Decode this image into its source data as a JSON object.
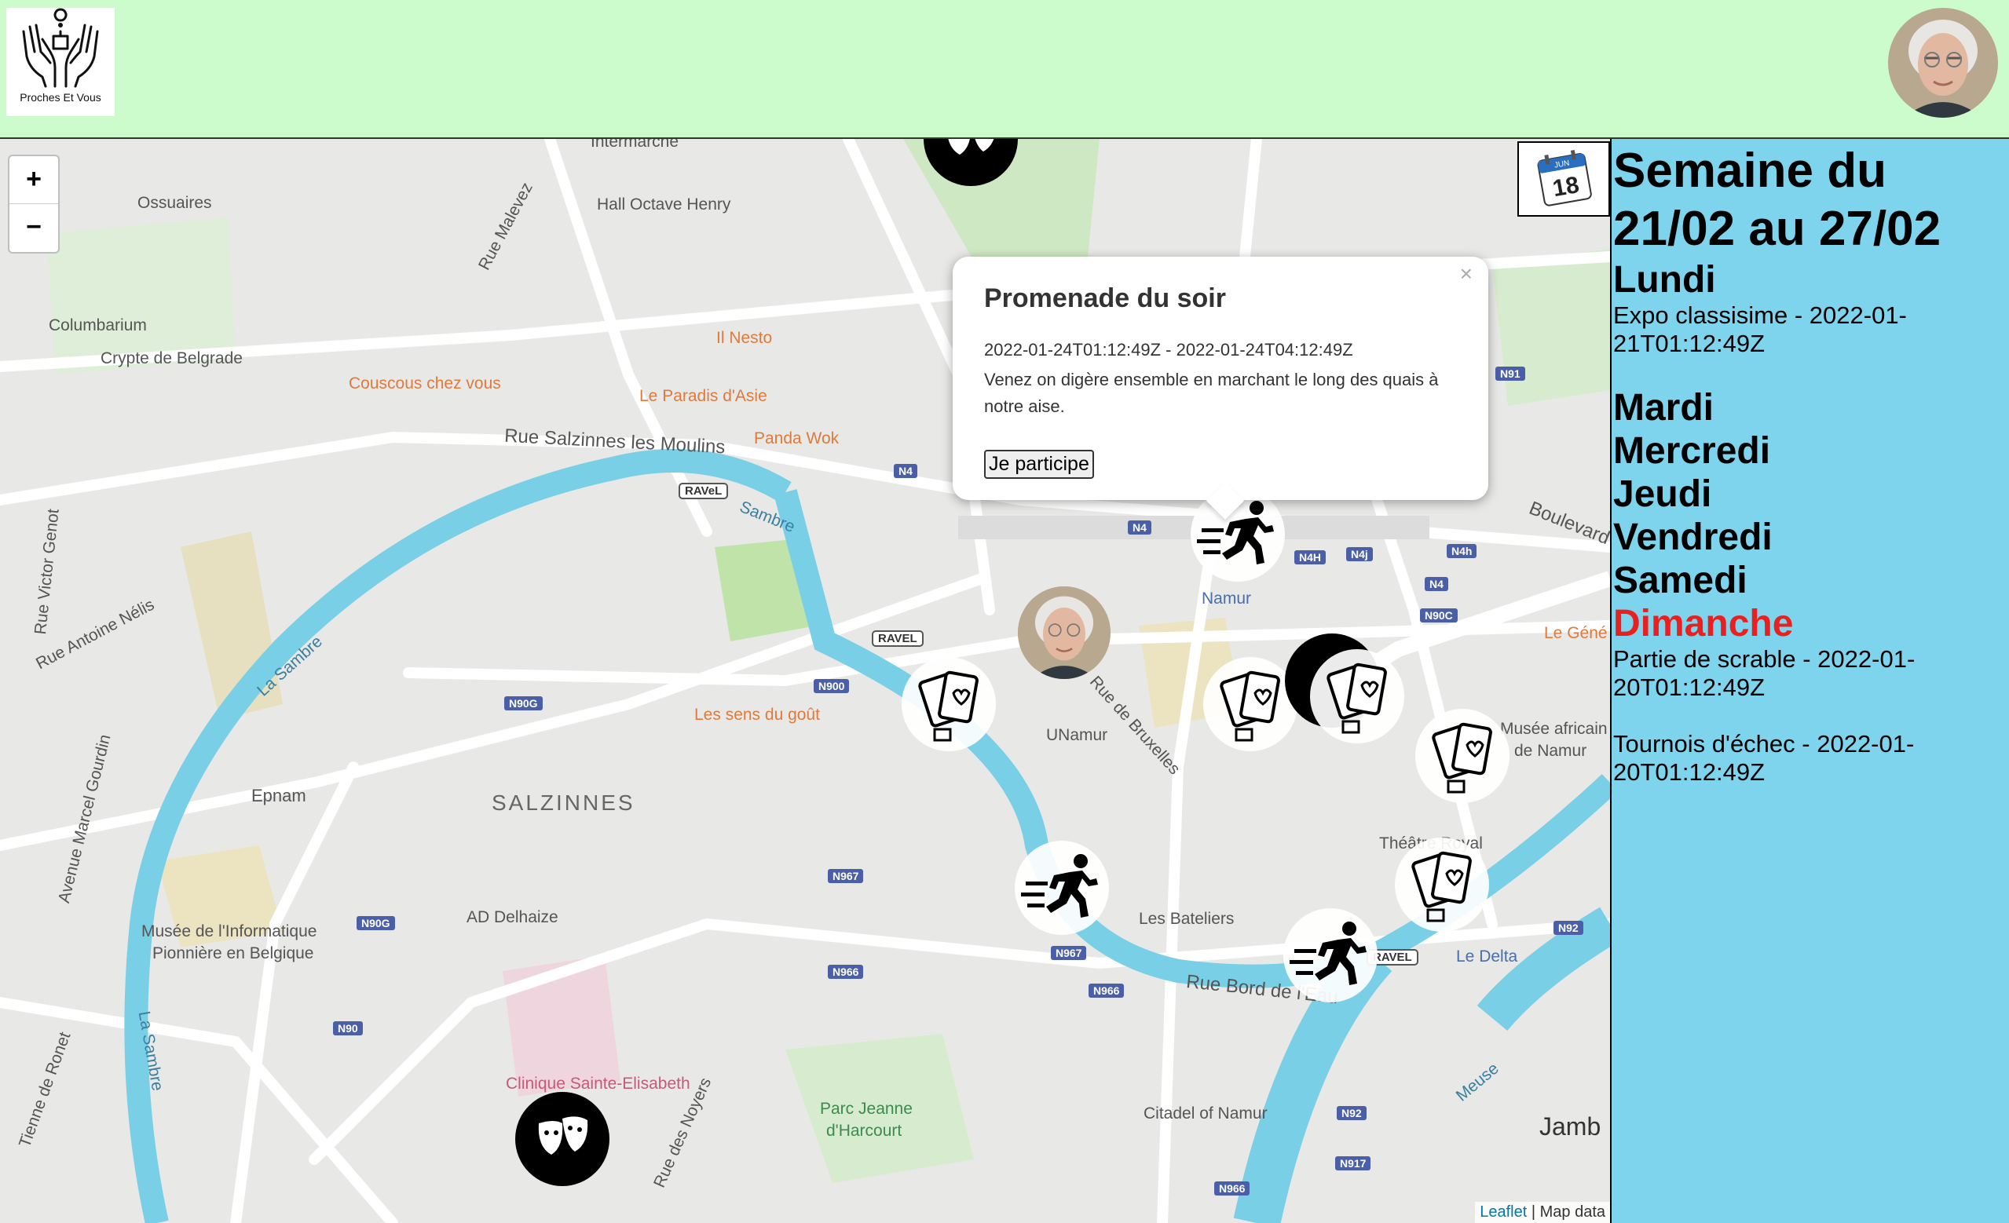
{
  "header": {
    "logo_text": "Proches Et Vous",
    "logo_icon": "hands-map-pin-icon"
  },
  "map": {
    "zoom_in_label": "+",
    "zoom_out_label": "−",
    "attribution_link": "Leaflet",
    "attribution_text": " | Map data",
    "labels": {
      "intermarche": "Intermarché",
      "ossuaires": "Ossuaires",
      "hall_octave": "Hall Octave Henry",
      "rue_malevez": "Rue Malevez",
      "columbarium": "Columbarium",
      "crypte": "Crypte de Belgrade",
      "couscous": "Couscous chez vous",
      "il_nesto": "Il Nesto",
      "paradis": "Le Paradis d'Asie",
      "panda": "Panda Wok",
      "rue_salzinnes": "Rue Salzinnes les Moulins",
      "sambre_river": "Sambre",
      "la_sambre1": "La Sambre",
      "la_sambre2": "La Sambre",
      "rue_victor": "Rue Victor Genot",
      "rue_antoine": "Rue Antoine Nélis",
      "avenue_marcel": "Avenue Marcel Gourdin",
      "epnam": "Epnam",
      "salzinnes": "SALZINNES",
      "sens_gout": "Les sens du goût",
      "namur": "Namur",
      "unamur": "UNamur",
      "rue_bruxelles": "Rue de Bruxelles",
      "boulevard": "Boulevard",
      "le_gene": "Le Géné",
      "musee_africain1": "Musée africain",
      "musee_africain2": "de Namur",
      "theatre": "Théâtre Royal",
      "musee_info1": "Musée de l'Informatique",
      "musee_info2": "Pionnière en Belgique",
      "ad_delhaize": "AD Delhaize",
      "les_bateliers": "Les Bateliers",
      "le_delta": "Le Delta",
      "rue_bord": "Rue Bord de l'Eau",
      "clinique": "Clinique Sainte-Elisabeth",
      "rue_noyers": "Rue des Noyers",
      "parc1": "Parc Jeanne",
      "parc2": "d'Harcourt",
      "citadel": "Citadel of Namur",
      "meuse": "Meuse",
      "jambes": "Jamb",
      "tienne": "Tienne de Ronet"
    },
    "roads": {
      "n4a": "N4",
      "n4b": "N4",
      "n4h1": "N4H",
      "n4j": "N4j",
      "n4h2": "N4h",
      "n4c": "N4",
      "n90c": "N90C",
      "n91": "N91",
      "n90g1": "N90G",
      "n900": "N900",
      "n967a": "N967",
      "n90g2": "N90G",
      "n966a": "N966",
      "n967b": "N967",
      "n966b": "N966",
      "n90": "N90",
      "n92a": "N92",
      "n92b": "N92",
      "n917": "N917",
      "n966c": "N966",
      "ravel1": "RAVeL",
      "ravel2": "RAVEL",
      "ravel3": "RAVEL"
    },
    "markers": [
      {
        "type": "theater",
        "icon": "theater-masks-icon"
      },
      {
        "type": "running",
        "icon": "running-icon"
      },
      {
        "type": "cards",
        "icon": "playing-cards-icon"
      },
      {
        "type": "cards",
        "icon": "playing-cards-icon"
      },
      {
        "type": "cards",
        "icon": "playing-cards-icon"
      },
      {
        "type": "cards",
        "icon": "playing-cards-icon"
      },
      {
        "type": "cards",
        "icon": "playing-cards-icon"
      },
      {
        "type": "running",
        "icon": "running-icon"
      },
      {
        "type": "running",
        "icon": "running-icon"
      },
      {
        "type": "theater",
        "icon": "theater-masks-icon"
      }
    ],
    "popup": {
      "title": "Promenade du soir",
      "close": "×",
      "dates": "2022-01-24T01:12:49Z - 2022-01-24T04:12:49Z",
      "description": "Venez on digère ensemble en marchant le long des quais à notre aise.",
      "button_label": "Je participe"
    }
  },
  "calendar_button": {
    "icon": "calendar-icon",
    "month": "JUN",
    "day": "18"
  },
  "sidebar": {
    "week_title": "Semaine du 21/02 au 27/02",
    "today_color": "#e82020",
    "days": [
      {
        "name": "Lundi",
        "events": [
          "Expo classisime - 2022-01-21T01:12:49Z"
        ]
      },
      {
        "name": "Mardi",
        "events": []
      },
      {
        "name": "Mercredi",
        "events": []
      },
      {
        "name": "Jeudi",
        "events": []
      },
      {
        "name": "Vendredi",
        "events": []
      },
      {
        "name": "Samedi",
        "events": []
      },
      {
        "name": "Dimanche",
        "today": true,
        "events": [
          "Partie de scrable - 2022-01-20T01:12:49Z",
          "Tournois d'échec - 2022-01-20T01:12:49Z"
        ]
      }
    ]
  }
}
